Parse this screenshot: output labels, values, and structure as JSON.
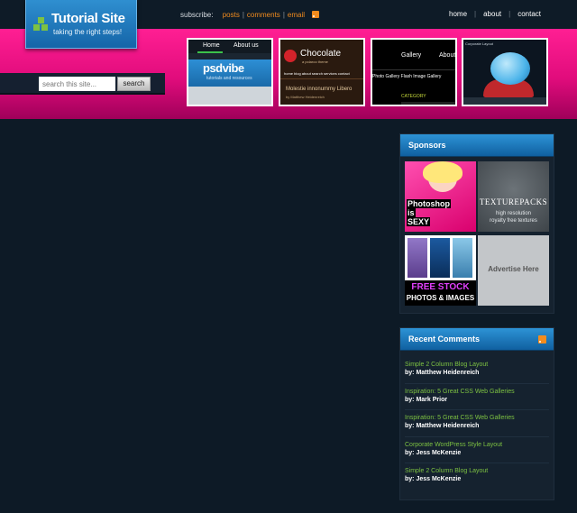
{
  "logo": {
    "title": "Tutorial Site",
    "tagline": "taking the right steps!",
    "colors": {
      "accent": "#7dc242",
      "brand": "#1f7dc3"
    }
  },
  "subscribe": {
    "label": "subscribe:",
    "links": [
      "posts",
      "comments",
      "email"
    ],
    "icon": "rss-icon"
  },
  "nav": {
    "items": [
      "home",
      "about",
      "contact"
    ]
  },
  "search": {
    "placeholder": "search this site...",
    "button": "search"
  },
  "theme": {
    "pink": "#e10c7c",
    "background": "#0d1a26",
    "link_color": "#7dc242"
  },
  "thumbnails": [
    {
      "nav": [
        "Home",
        "About us"
      ],
      "brand": "psdvibe",
      "sub": "tutorials and resources"
    },
    {
      "name": "Chocolate",
      "tagline": "a polaroo theme",
      "menu": "home   blog   about   search   services   contact",
      "headline": "Molestie innonummy Libero",
      "author": "by Matthew Heidenreich"
    },
    {
      "nav": [
        "Gallery",
        "About"
      ],
      "links": "Photo Gallery      Flash Image Gallery",
      "category": "CATEGORY"
    },
    {
      "label": "Corporate Layout"
    }
  ],
  "sponsors": {
    "title": "Sponsors",
    "ads": [
      {
        "lines": [
          "Photoshop",
          "is",
          "SEXY"
        ]
      },
      {
        "name": "TEXTUREPACKS",
        "desc": [
          "high resolution",
          "royalty free textures"
        ]
      },
      {
        "lines": [
          "FREE STOCK",
          "PHOTOS & IMAGES"
        ]
      },
      {
        "text": "Advertise Here"
      }
    ]
  },
  "recent_comments": {
    "title": "Recent Comments",
    "icon": "rss-icon",
    "items": [
      {
        "title": "Simple 2 Column Blog Layout",
        "by": "by: Matthew Heidenreich"
      },
      {
        "title": "Inspiration: 5 Great CSS Web Galleries",
        "by": "by: Mark Prior"
      },
      {
        "title": "Inspiration: 5 Great CSS Web Galleries",
        "by": "by: Matthew Heidenreich"
      },
      {
        "title": "Corporate WordPress Style Layout",
        "by": "by: Jess McKenzie"
      },
      {
        "title": "Simple 2 Column Blog Layout",
        "by": "by: Jess McKenzie"
      }
    ]
  }
}
